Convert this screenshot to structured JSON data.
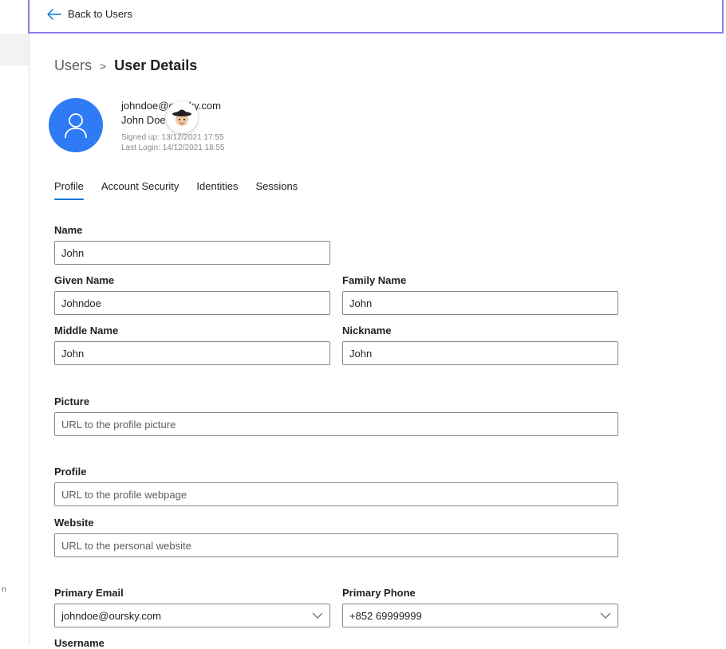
{
  "topbar": {
    "back_label": "Back to Users"
  },
  "left_rail": {
    "fragment_text": "n"
  },
  "breadcrumb": {
    "parent": "Users",
    "separator": ">",
    "current": "User Details"
  },
  "user": {
    "email": "johndoe@oursky.com",
    "name": "John Doe",
    "signed_up": "Signed up: 13/12/2021 17:55",
    "last_login": "Last Login: 14/12/2021 18:55"
  },
  "tabs": [
    {
      "label": "Profile",
      "active": true
    },
    {
      "label": "Account Security",
      "active": false
    },
    {
      "label": "Identities",
      "active": false
    },
    {
      "label": "Sessions",
      "active": false
    }
  ],
  "form": {
    "name": {
      "label": "Name",
      "value": "John"
    },
    "given_name": {
      "label": "Given Name",
      "value": "Johndoe"
    },
    "family_name": {
      "label": "Family Name",
      "value": "John"
    },
    "middle_name": {
      "label": "Middle Name",
      "value": "John"
    },
    "nickname": {
      "label": "Nickname",
      "value": "John"
    },
    "picture": {
      "label": "Picture",
      "placeholder": "URL to the profile picture"
    },
    "profile": {
      "label": "Profile",
      "placeholder": "URL to the profile webpage"
    },
    "website": {
      "label": "Website",
      "placeholder": "URL to the personal website"
    },
    "primary_email": {
      "label": "Primary Email",
      "value": "johndoe@oursky.com"
    },
    "primary_phone": {
      "label": "Primary Phone",
      "value": "+852 69999999"
    },
    "username": {
      "label": "Username"
    }
  },
  "colors": {
    "accent": "#0078d4",
    "avatar_bg": "#2f7bf5",
    "topbar_border": "#8c7ae6"
  }
}
